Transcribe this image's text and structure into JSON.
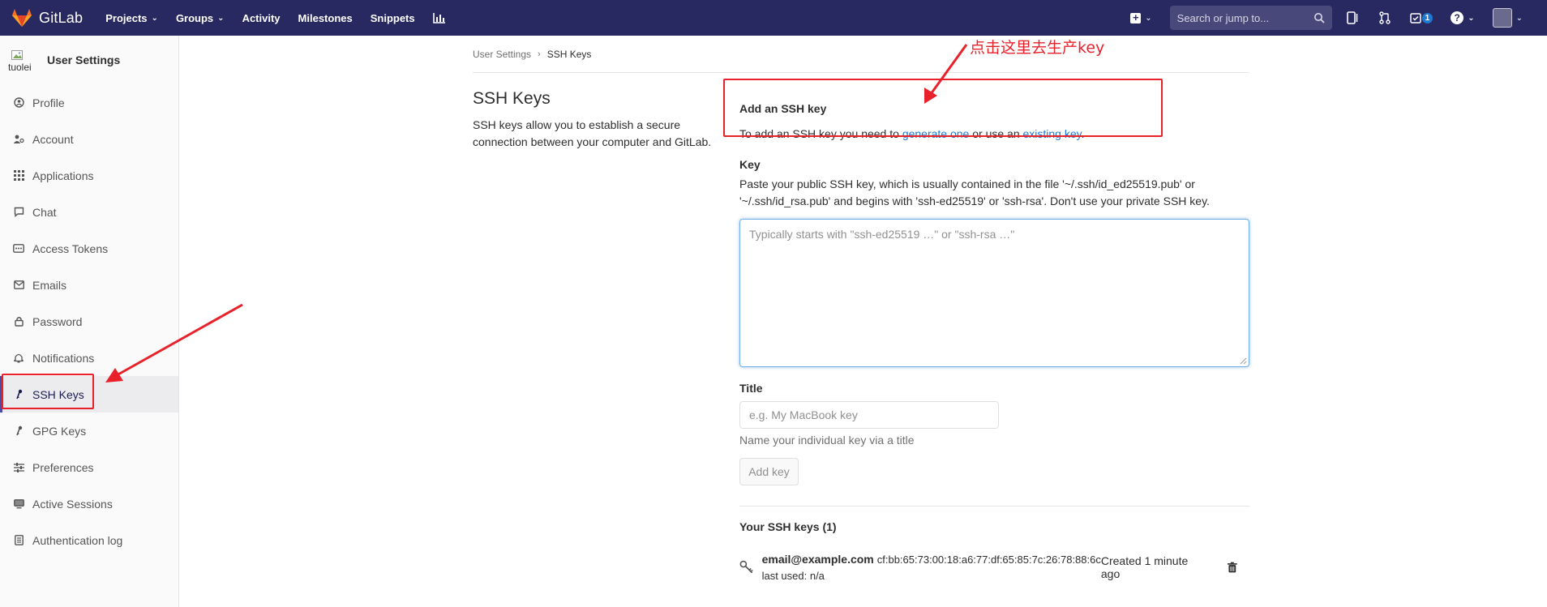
{
  "navbar": {
    "brand": "GitLab",
    "links": [
      {
        "label": "Projects",
        "caret": true
      },
      {
        "label": "Groups",
        "caret": true
      },
      {
        "label": "Activity",
        "caret": false
      },
      {
        "label": "Milestones",
        "caret": false
      },
      {
        "label": "Snippets",
        "caret": false
      }
    ],
    "search_placeholder": "Search or jump to...",
    "todo_count": "1",
    "accent": "#292961"
  },
  "sidebar": {
    "avatar_alt": "tuolei",
    "title": "User Settings",
    "items": [
      {
        "label": "Profile",
        "icon": "profile-icon"
      },
      {
        "label": "Account",
        "icon": "account-icon"
      },
      {
        "label": "Applications",
        "icon": "applications-icon"
      },
      {
        "label": "Chat",
        "icon": "chat-icon"
      },
      {
        "label": "Access Tokens",
        "icon": "token-icon"
      },
      {
        "label": "Emails",
        "icon": "email-icon"
      },
      {
        "label": "Password",
        "icon": "lock-icon"
      },
      {
        "label": "Notifications",
        "icon": "bell-icon"
      },
      {
        "label": "SSH Keys",
        "icon": "key-icon",
        "active": true
      },
      {
        "label": "GPG Keys",
        "icon": "key-icon"
      },
      {
        "label": "Preferences",
        "icon": "sliders-icon"
      },
      {
        "label": "Active Sessions",
        "icon": "monitor-icon"
      },
      {
        "label": "Authentication log",
        "icon": "log-icon"
      }
    ]
  },
  "breadcrumb": {
    "parent": "User Settings",
    "current": "SSH Keys"
  },
  "page": {
    "title": "SSH Keys",
    "description": "SSH keys allow you to establish a secure connection between your computer and GitLab."
  },
  "add_key": {
    "title": "Add an SSH key",
    "text_before": "To add an SSH key you need to",
    "link1": "generate one",
    "text_middle": "or use an",
    "link2": "existing key",
    "text_after": "."
  },
  "form": {
    "key_label": "Key",
    "key_help_line1": "Paste your public SSH key, which is usually contained in the file '~/.ssh/id_ed25519.pub' or",
    "key_help_line2": "'~/.ssh/id_rsa.pub' and begins with 'ssh-ed25519' or 'ssh-rsa'. Don't use your private SSH key.",
    "key_placeholder": "Typically starts with \"ssh-ed25519 …\" or \"ssh-rsa …\"",
    "title_label": "Title",
    "title_placeholder": "e.g. My MacBook key",
    "title_help": "Name your individual key via a title",
    "submit": "Add key"
  },
  "keys": {
    "heading": "Your SSH keys (1)",
    "items": [
      {
        "email": "email@example.com",
        "fingerprint": "cf:bb:65:73:00:18:a6:77:df:65:85:7c:26:78:88:6c",
        "last_used": "last used: n/a",
        "created": "Created 1 minute ago"
      }
    ]
  },
  "annotation": {
    "note": "点击这里去生产key",
    "color": "#e8212b"
  }
}
